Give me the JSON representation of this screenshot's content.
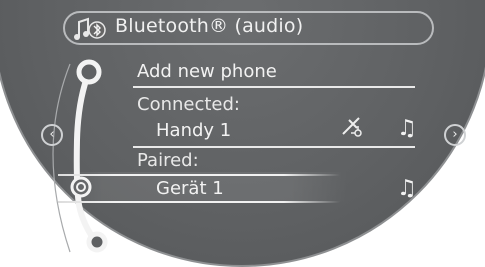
{
  "header": {
    "title": "Bluetooth® (audio)",
    "icon": "bluetooth-audio-icon"
  },
  "menu": {
    "items": [
      {
        "label": "Add new phone",
        "kind": "action"
      },
      {
        "label": "Connected:",
        "kind": "section"
      },
      {
        "label": "Handy 1",
        "kind": "device",
        "icons": [
          "phone-settings-icon",
          "music-note-icon"
        ]
      },
      {
        "label": "Paired:",
        "kind": "section"
      },
      {
        "label": "Gerät 1",
        "kind": "device",
        "selected": true,
        "icons": [
          "music-note-icon"
        ]
      }
    ]
  },
  "navigation": {
    "left_arrow_icon": "chevron-left-icon",
    "right_arrow_icon": "chevron-right-icon",
    "scroll_icon": "menu-slider-icon"
  },
  "colors": {
    "background": "#5f6163",
    "text": "#f2f2f2",
    "divider": "#e9e9e9"
  }
}
